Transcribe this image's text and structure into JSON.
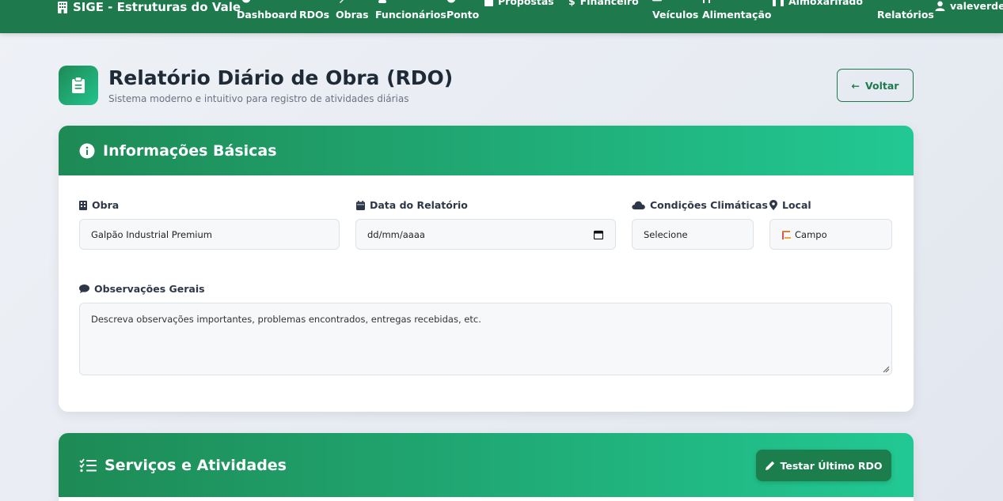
{
  "navbar": {
    "brand": "SIGE - Estruturas do Vale",
    "items": [
      {
        "label": "Dashboard"
      },
      {
        "label": "RDOs"
      },
      {
        "label": "Obras"
      },
      {
        "label": "Funcionários"
      },
      {
        "label": "Ponto"
      },
      {
        "label": "Propostas"
      },
      {
        "label": "Financeiro"
      },
      {
        "label": "Veículos"
      },
      {
        "label": "Alimentação"
      },
      {
        "label": "Almoxarifado"
      },
      {
        "label": "Relatórios"
      }
    ],
    "user": "valeverde"
  },
  "header": {
    "title": "Relatório Diário de Obra (RDO)",
    "subtitle": "Sistema moderno e intuitivo para registro de atividades diárias",
    "back_label": "Voltar"
  },
  "basic_info": {
    "title": "Informações Básicas",
    "obra": {
      "label": "Obra",
      "value": "Galpão Industrial Premium"
    },
    "data": {
      "label": "Data do Relatório",
      "value": "dd/mm/aaaa"
    },
    "clima": {
      "label": "Condições Climáticas",
      "value": "Selecione"
    },
    "local": {
      "label": "Local",
      "value": "Campo"
    },
    "obs": {
      "label": "Observações Gerais",
      "placeholder": "Descreva observações importantes, problemas encontrados, entregas recebidas, etc."
    }
  },
  "services": {
    "title": "Serviços e Atividades",
    "test_button": "Testar Último RDO"
  },
  "colors": {
    "primary": "#1e7a4c",
    "gradient_start": "#1e8a55",
    "gradient_end": "#22c893"
  }
}
